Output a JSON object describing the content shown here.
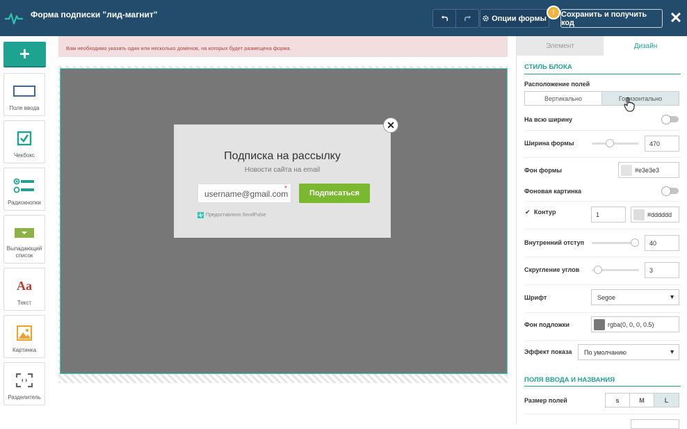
{
  "header": {
    "title": "Форма подписки \"лид-магнит\"",
    "options_label": "Опции формы",
    "save_label": "Сохранить и получить код",
    "close_glyph": "✕",
    "warning_glyph": "!"
  },
  "toolbox": {
    "add_glyph": "+",
    "items": [
      {
        "label": "Поле ввода",
        "icon": "input-field-icon"
      },
      {
        "label": "Чекбокс",
        "icon": "checkbox-icon"
      },
      {
        "label": "Радиокнопки",
        "icon": "radio-buttons-icon"
      },
      {
        "label": "Выпадающий список",
        "icon": "dropdown-icon"
      },
      {
        "label": "Текст",
        "icon": "text-icon"
      },
      {
        "label": "Картинка",
        "icon": "image-icon"
      },
      {
        "label": "Разделитель",
        "icon": "divider-icon"
      }
    ],
    "text_icon_glyph": "Aa"
  },
  "alert": {
    "text": "Вам необходимо указать один или несколько доменов, на которых будет размещена форма."
  },
  "popup": {
    "title": "Подписка на рассылку",
    "subtitle": "Новости сайта на email",
    "email_placeholder": "username@gmail.com",
    "required_mark": "*",
    "subscribe_label": "Подписаться",
    "powered_by": "Предоставлено SendPulse",
    "close_glyph": "✕"
  },
  "panel": {
    "tabs": [
      {
        "label": "Элемент",
        "active": false
      },
      {
        "label": "Дизайн",
        "active": true
      }
    ],
    "block_style_title": "СТИЛЬ БЛОКА",
    "field_layout_label": "Расположение полей",
    "layout_options": [
      "Вертикально",
      "Горизонтально"
    ],
    "layout_selected": "Горизонтально",
    "full_width_label": "На всю ширину",
    "full_width_on": false,
    "form_width_label": "Ширина формы",
    "form_width_value": "470",
    "form_bg_label": "Фон формы",
    "form_bg_value": "#e3e3e3",
    "bg_image_label": "Фоновая картинка",
    "bg_image_on": false,
    "border_label": "Контур",
    "border_checked": true,
    "check_glyph": "✔",
    "border_width_value": "1",
    "border_color_value": "#dddddd",
    "padding_label": "Внутренний отступ",
    "padding_value": "40",
    "radius_label": "Скругление углов",
    "radius_value": "3",
    "font_label": "Шрифт",
    "font_value": "Segoe",
    "overlay_label": "Фон подложки",
    "overlay_value": "rgba(0, 0, 0, 0.5)",
    "effect_label": "Эффект показа",
    "effect_value": "По умолчанию",
    "fields_title": "ПОЛЯ ВВОДА И НАЗВАНИЯ",
    "field_size_label": "Размер полей",
    "field_sizes": [
      "s",
      "M",
      "L"
    ],
    "field_size_selected": "L",
    "dropdown_arrow": "▼"
  },
  "colors": {
    "header_bg": "#234b6c",
    "accent": "#1fa391",
    "subscribe_bg": "#7ab830",
    "alert_bg": "#f2dede",
    "overlay_bg": "#777777",
    "popup_bg": "#e3e3e3",
    "warning": "#f2b33d"
  }
}
